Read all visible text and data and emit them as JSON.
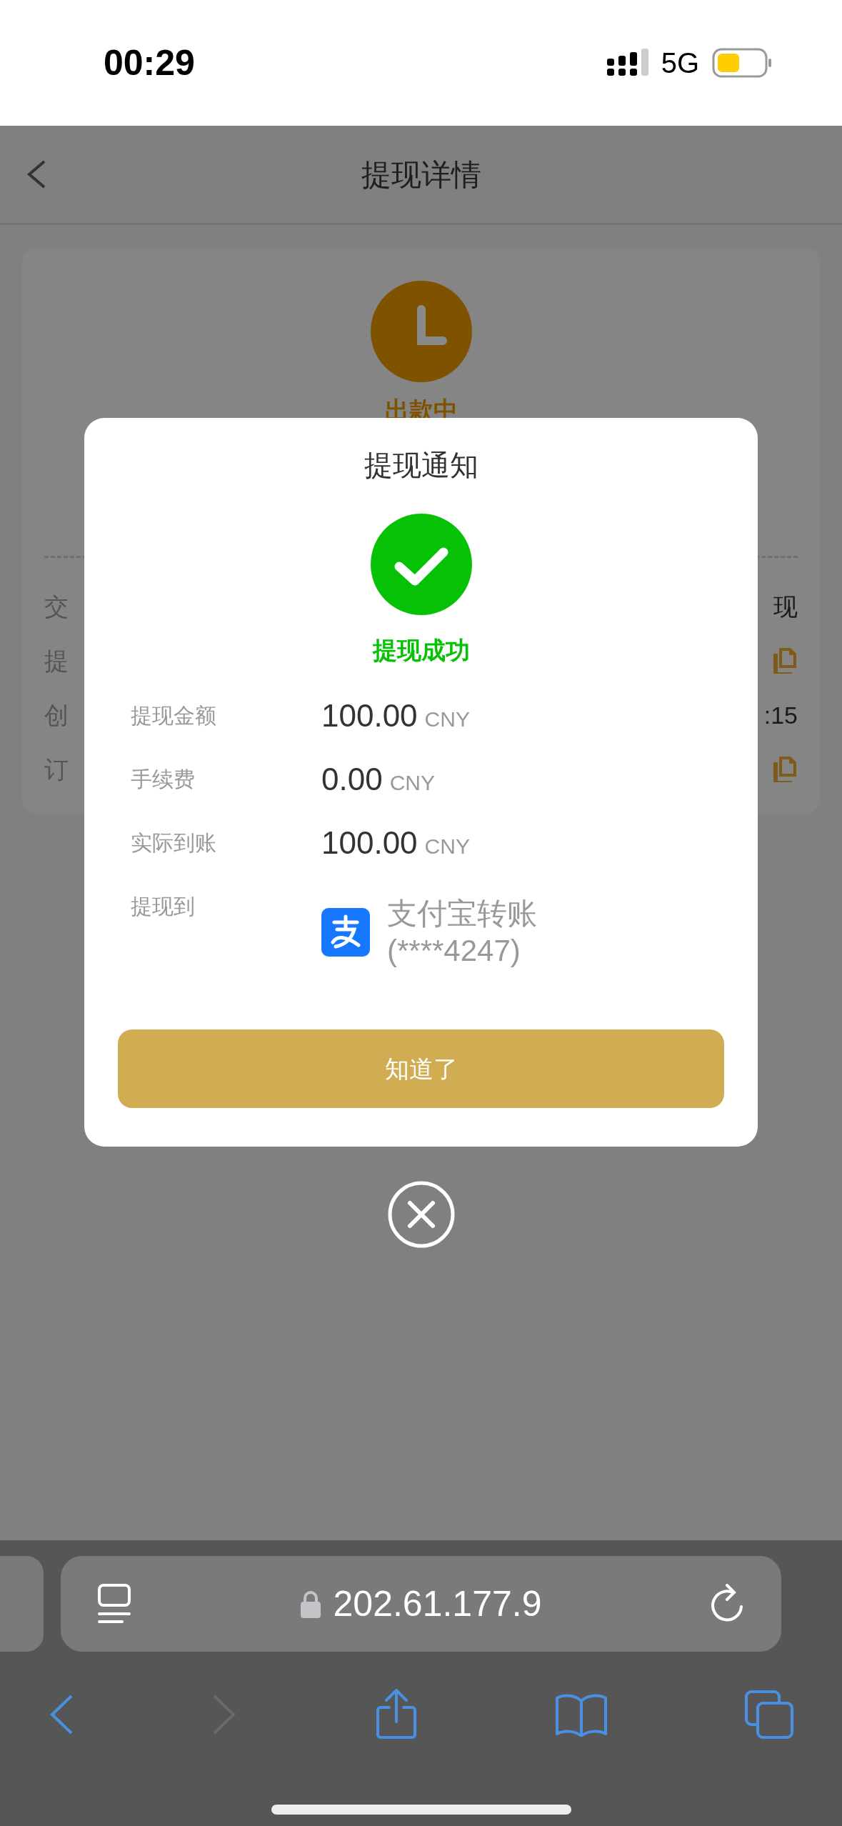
{
  "status_bar": {
    "time": "00:29",
    "network": "5G"
  },
  "header": {
    "title": "提现详情"
  },
  "order_card": {
    "status": "出款中",
    "rows": [
      {
        "label": "交",
        "kind": "text",
        "value": "现"
      },
      {
        "label": "提",
        "kind": "copy"
      },
      {
        "label": "创",
        "kind": "text",
        "value": ":15"
      },
      {
        "label": "订",
        "kind": "copy"
      }
    ]
  },
  "dialog": {
    "title": "提现通知",
    "result": "提现成功",
    "rows": [
      {
        "label": "提现金额",
        "kind": "amount",
        "amount": "100.00",
        "currency": "CNY"
      },
      {
        "label": "手续费",
        "kind": "amount",
        "amount": "0.00",
        "currency": "CNY"
      },
      {
        "label": "实际到账",
        "kind": "amount",
        "amount": "100.00",
        "currency": "CNY"
      },
      {
        "label": "提现到",
        "kind": "account",
        "method": "支付宝转账",
        "account": "(****4247)"
      }
    ],
    "confirm_button": "知道了"
  },
  "browser": {
    "url": "202.61.177.9"
  }
}
